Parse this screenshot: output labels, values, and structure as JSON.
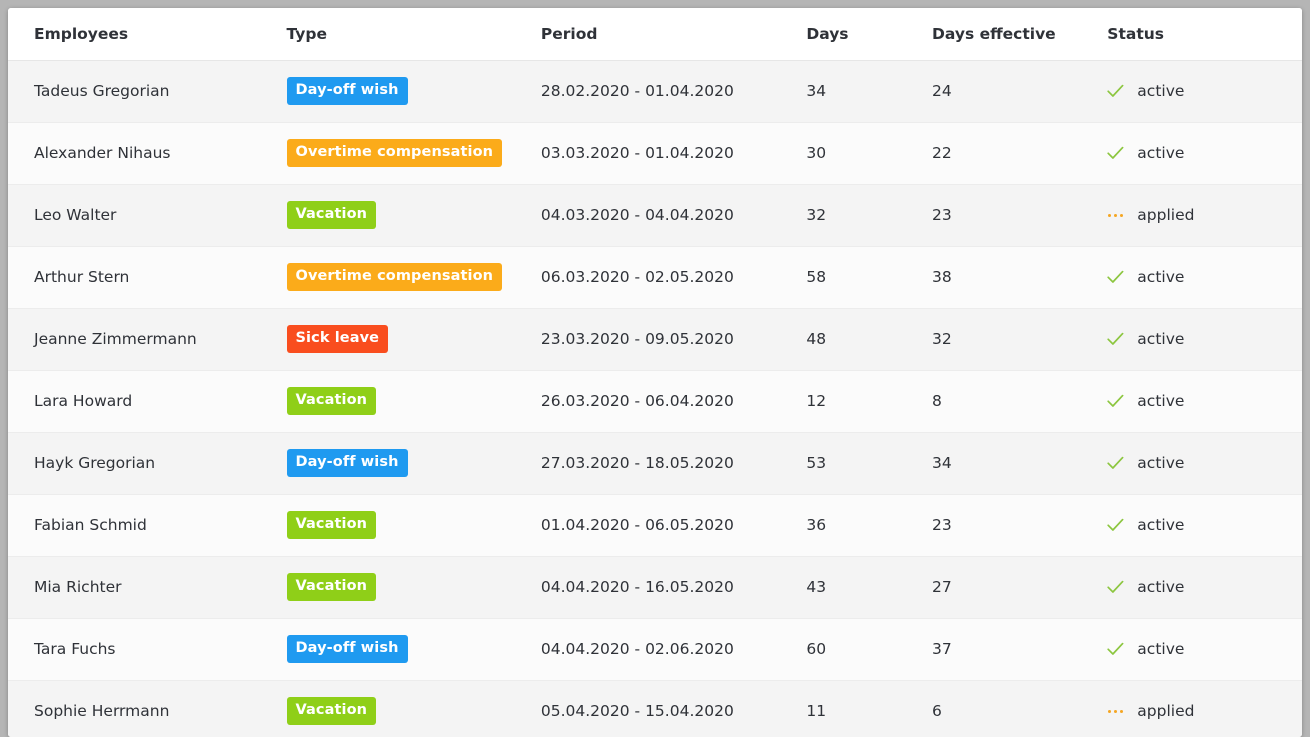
{
  "table": {
    "columns": [
      {
        "key": "employee",
        "label": "Employees"
      },
      {
        "key": "type",
        "label": "Type"
      },
      {
        "key": "period",
        "label": "Period"
      },
      {
        "key": "days",
        "label": "Days"
      },
      {
        "key": "days_eff",
        "label": "Days effective"
      },
      {
        "key": "status",
        "label": "Status"
      }
    ],
    "type_colors": {
      "Day-off wish": "#1f9af0",
      "Overtime compensation": "#fbab1a",
      "Vacation": "#8fcf18",
      "Sick leave": "#f94d1e"
    },
    "status_colors": {
      "active": "#8cc63f",
      "applied": "#f5a623"
    },
    "status_icons": {
      "active": "check-icon",
      "applied": "ellipsis-icon"
    },
    "rows": [
      {
        "employee": "Tadeus Gregorian",
        "type": "Day-off wish",
        "period": "28.02.2020 - 01.04.2020",
        "days": "34",
        "days_eff": "24",
        "status": "active"
      },
      {
        "employee": "Alexander Nihaus",
        "type": "Overtime compensation",
        "period": "03.03.2020 - 01.04.2020",
        "days": "30",
        "days_eff": "22",
        "status": "active"
      },
      {
        "employee": "Leo Walter",
        "type": "Vacation",
        "period": "04.03.2020 - 04.04.2020",
        "days": "32",
        "days_eff": "23",
        "status": "applied"
      },
      {
        "employee": "Arthur Stern",
        "type": "Overtime compensation",
        "period": "06.03.2020 - 02.05.2020",
        "days": "58",
        "days_eff": "38",
        "status": "active"
      },
      {
        "employee": "Jeanne Zimmermann",
        "type": "Sick leave",
        "period": "23.03.2020 - 09.05.2020",
        "days": "48",
        "days_eff": "32",
        "status": "active"
      },
      {
        "employee": "Lara Howard",
        "type": "Vacation",
        "period": "26.03.2020 - 06.04.2020",
        "days": "12",
        "days_eff": "8",
        "status": "active"
      },
      {
        "employee": "Hayk Gregorian",
        "type": "Day-off wish",
        "period": "27.03.2020 - 18.05.2020",
        "days": "53",
        "days_eff": "34",
        "status": "active"
      },
      {
        "employee": "Fabian Schmid",
        "type": "Vacation",
        "period": "01.04.2020 - 06.05.2020",
        "days": "36",
        "days_eff": "23",
        "status": "active"
      },
      {
        "employee": "Mia Richter",
        "type": "Vacation",
        "period": "04.04.2020 - 16.05.2020",
        "days": "43",
        "days_eff": "27",
        "status": "active"
      },
      {
        "employee": "Tara Fuchs",
        "type": "Day-off wish",
        "period": "04.04.2020 - 02.06.2020",
        "days": "60",
        "days_eff": "37",
        "status": "active"
      },
      {
        "employee": "Sophie Herrmann",
        "type": "Vacation",
        "period": "05.04.2020 - 15.04.2020",
        "days": "11",
        "days_eff": "6",
        "status": "applied"
      }
    ]
  }
}
